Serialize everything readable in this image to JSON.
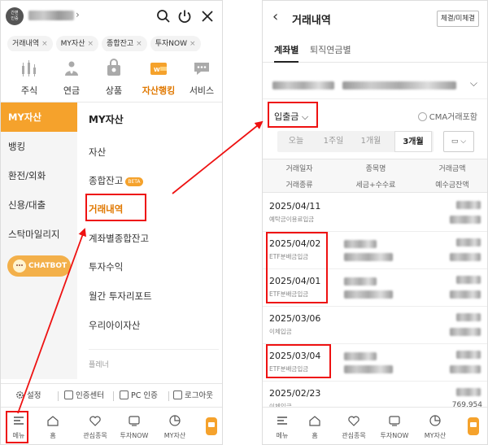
{
  "left": {
    "user": {
      "avatar_text_1": "간편",
      "avatar_text_2": "인증",
      "chevron": "›"
    },
    "chips": [
      "거래내역",
      "MY자산",
      "종합잔고",
      "투자NOW"
    ],
    "chip_close": "×",
    "categories": [
      {
        "label": "주식",
        "icon": "stock-chart-icon"
      },
      {
        "label": "연금",
        "icon": "pension-icon"
      },
      {
        "label": "상품",
        "icon": "product-bag-icon"
      },
      {
        "label": "자산행킹",
        "icon": "wallet-icon"
      },
      {
        "label": "서비스",
        "icon": "chat-icon"
      }
    ],
    "sidebar": [
      "MY자산",
      "뱅킹",
      "환전/외화",
      "신용/대출",
      "스탁마일리지"
    ],
    "chatbot_label": "CHATBOT",
    "menu_head": "MY자산",
    "menu_items": [
      "자산",
      "종합잔고",
      "거래내역",
      "계좌별종합잔고",
      "투자수익",
      "월간 투자리포트",
      "우리아이자산"
    ],
    "beta": "BETA",
    "menu_faint": "플레너",
    "util": [
      "설정",
      "인증센터",
      "PC 인증",
      "로그아웃"
    ],
    "tabbar": [
      "메뉴",
      "홈",
      "관심종목",
      "투자NOW",
      "MY자산"
    ]
  },
  "right": {
    "back": "‹",
    "title": "거래내역",
    "top_button": "체결/미체결",
    "tabs": [
      "계좌별",
      "퇴직연금별"
    ],
    "acct_chevron": "⌵",
    "dropdown": "입출금 ⌵",
    "cma_label": "CMA거래포함",
    "periods": [
      "오늘",
      "1주일",
      "1개월",
      "3개월"
    ],
    "cal_label": "▭ ⌵",
    "headers": {
      "date": "거래일자",
      "kind": "거래종류",
      "item": "종목명",
      "fee": "세금+수수료",
      "amount": "거래금액",
      "balance": "예수금잔액"
    },
    "rows": [
      {
        "date": "2025/04/11",
        "type": "예탁금이용료입금"
      },
      {
        "date": "2025/04/02",
        "type": "ETF분배금입금"
      },
      {
        "date": "2025/04/01",
        "type": "ETF분배금입금"
      },
      {
        "date": "2025/03/06",
        "type": "이체입금"
      },
      {
        "date": "2025/03/04",
        "type": "ETF분배금입금"
      },
      {
        "date": "2025/02/23",
        "type": "이체입금"
      }
    ],
    "last_visible_amount": "769,954",
    "tabbar": [
      "메뉴",
      "홈",
      "관심종목",
      "투자NOW",
      "MY자산"
    ]
  },
  "colors": {
    "accent": "#f5a22c",
    "highlight": "#e11111"
  }
}
